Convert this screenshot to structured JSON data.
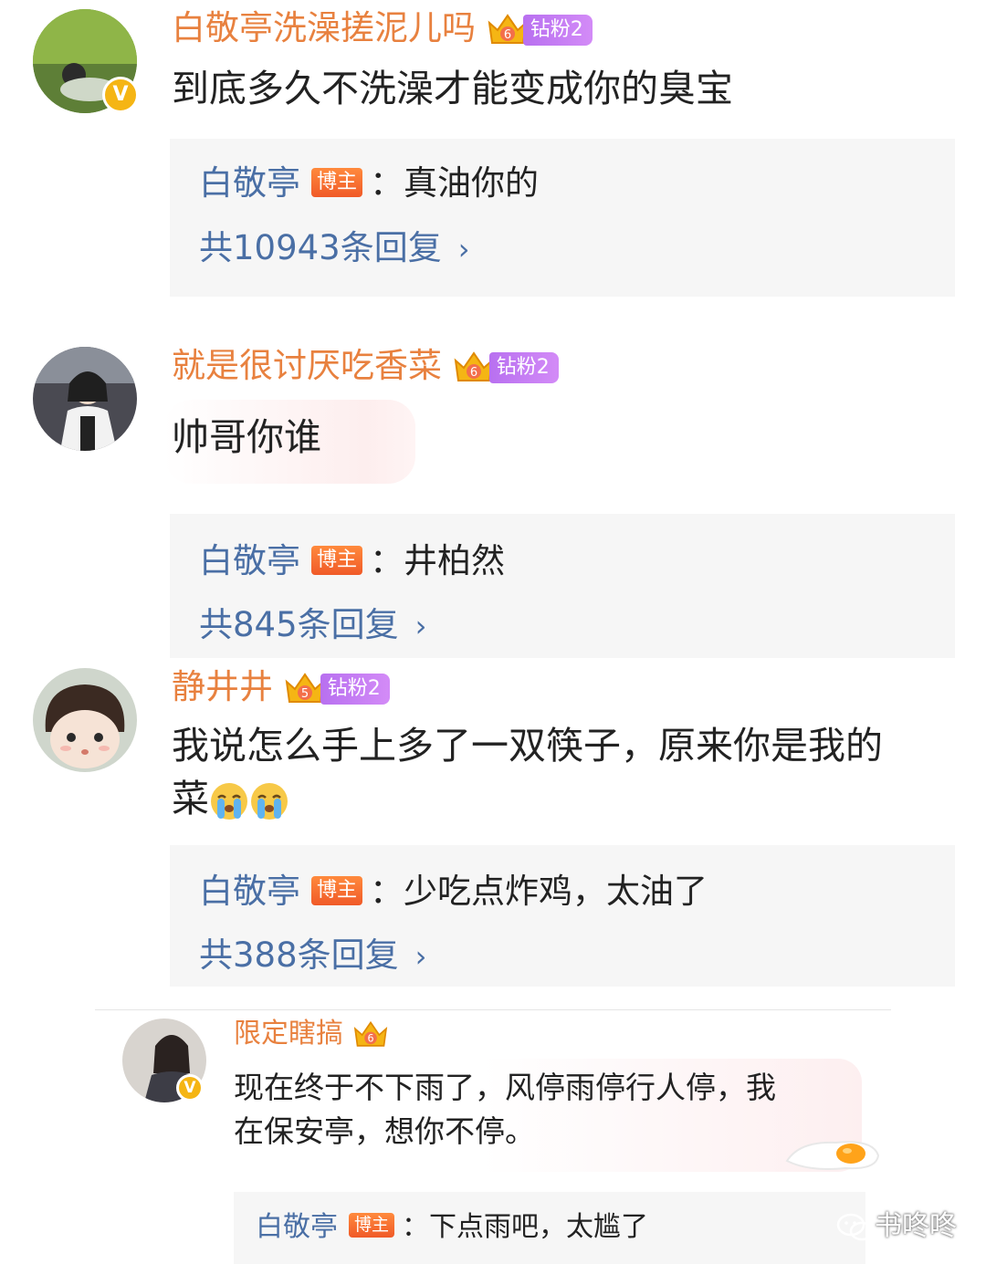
{
  "comments": [
    {
      "username": "白敬亭洗澡搓泥儿吗",
      "fan_badge": "钻粉2",
      "crown_level": "6",
      "verified": true,
      "text": "到底多久不洗澡才能变成你的臭宝",
      "reply": {
        "author": "白敬亭",
        "author_badge": "博主",
        "separator": "：",
        "text": "真油你的",
        "count_text": "共10943条回复"
      }
    },
    {
      "username": "就是很讨厌吃香菜",
      "fan_badge": "钻粉2",
      "crown_level": "6",
      "text": "帅哥你谁",
      "reply": {
        "author": "白敬亭",
        "author_badge": "博主",
        "separator": "：",
        "text": "井柏然",
        "count_text": "共845条回复"
      }
    },
    {
      "username": "静井井",
      "fan_badge": "钻粉2",
      "crown_level": "5",
      "text_line1": "我说怎么手上多了一双筷子，原来你是我的",
      "text_line2": "菜",
      "emojis": [
        "crying-face",
        "crying-face"
      ],
      "reply": {
        "author": "白敬亭",
        "author_badge": "博主",
        "separator": "：",
        "text": "少吃点炸鸡，太油了",
        "count_text": "共388条回复"
      }
    },
    {
      "username": "限定瞎搞",
      "crown_level": "6",
      "verified": true,
      "text_line1": "现在终于不下雨了，风停雨停行人停，我",
      "text_line2": "在保安亭，想你不停。",
      "reply": {
        "author": "白敬亭",
        "author_badge": "博主",
        "separator": "：",
        "text": "下点雨吧，太尴了"
      }
    }
  ],
  "watermark": "书咚咚",
  "colors": {
    "username": "#e8813f",
    "reply_name": "#4a6fa5",
    "reply_bg": "#f6f6f6",
    "fan_badge": "#c47cf5",
    "bozhu_badge": "#f26b2e",
    "verified": "#f5b514"
  }
}
